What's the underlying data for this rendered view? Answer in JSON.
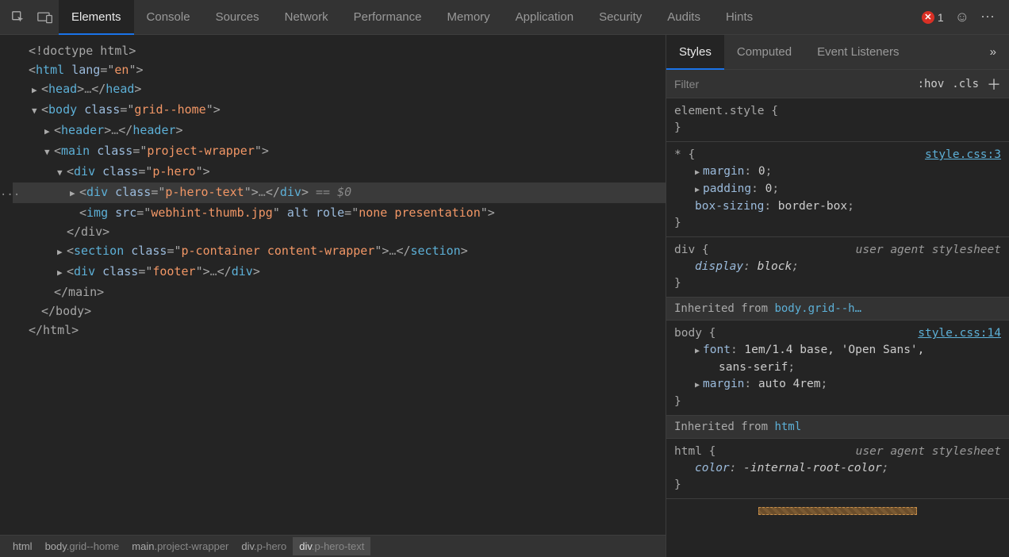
{
  "topTabs": {
    "items": [
      "Elements",
      "Console",
      "Sources",
      "Network",
      "Performance",
      "Memory",
      "Application",
      "Security",
      "Audits",
      "Hints"
    ],
    "active": 0
  },
  "errors": {
    "count": "1"
  },
  "tree": {
    "doctype": "<!doctype html>",
    "htmlOpen": {
      "tag": "html",
      "attrs": [
        {
          "n": "lang",
          "v": "en"
        }
      ]
    },
    "headCollapsed": {
      "tag": "head",
      "ell": "…"
    },
    "bodyOpen": {
      "tag": "body",
      "attrs": [
        {
          "n": "class",
          "v": "grid--home"
        }
      ]
    },
    "headerCollapsed": {
      "tag": "header",
      "ell": "…"
    },
    "mainOpen": {
      "tag": "main",
      "attrs": [
        {
          "n": "class",
          "v": "project-wrapper"
        }
      ]
    },
    "pheroOpen": {
      "tag": "div",
      "attrs": [
        {
          "n": "class",
          "v": "p-hero"
        }
      ]
    },
    "pheroTextCollapsed": {
      "tag": "div",
      "attrs": [
        {
          "n": "class",
          "v": "p-hero-text"
        }
      ],
      "ell": "…",
      "eq": "== $0"
    },
    "img": {
      "tag": "img",
      "attrs": [
        {
          "n": "src",
          "v": "webhint-thumb.jpg"
        },
        {
          "n": "alt",
          "flag": true
        },
        {
          "n": "role",
          "v": "none presentation"
        }
      ]
    },
    "pheroClose": "</div>",
    "sectionCollapsed": {
      "tag": "section",
      "attrs": [
        {
          "n": "class",
          "v": "p-container content-wrapper"
        }
      ],
      "ell": "…"
    },
    "footerCollapsed": {
      "tag": "div",
      "attrs": [
        {
          "n": "class",
          "v": "footer"
        }
      ],
      "ell": "…"
    },
    "mainClose": "</main>",
    "bodyClose": "</body>",
    "htmlClose": "</html>"
  },
  "crumbs": [
    {
      "label": "html"
    },
    {
      "label": "body",
      "suffix": ".grid--home"
    },
    {
      "label": "main",
      "suffix": ".project-wrapper"
    },
    {
      "label": "div",
      "suffix": ".p-hero"
    },
    {
      "label": "div",
      "suffix": ".p-hero-text",
      "active": true
    }
  ],
  "sideTabs": {
    "items": [
      "Styles",
      "Computed",
      "Event Listeners"
    ],
    "active": 0
  },
  "filter": {
    "placeholder": "Filter",
    "hov": ":hov",
    "cls": ".cls"
  },
  "rules": [
    {
      "selector": "element.style",
      "brace": "{",
      "props": [],
      "close": "}"
    },
    {
      "selector": "*",
      "brace": "{",
      "source": "style.css:3",
      "props": [
        {
          "n": "margin",
          "v": "0",
          "tri": true
        },
        {
          "n": "padding",
          "v": "0",
          "tri": true
        },
        {
          "n": "box-sizing",
          "v": "border-box"
        }
      ],
      "close": "}"
    },
    {
      "selector": "div",
      "brace": "{",
      "ua": "user agent stylesheet",
      "italic": true,
      "props": [
        {
          "n": "display",
          "v": "block",
          "italic": true
        }
      ],
      "close": "}"
    }
  ],
  "inherits": [
    {
      "label": "Inherited from",
      "from": "body.grid--h…",
      "rule": {
        "selector": "body",
        "brace": "{",
        "source": "style.css:14",
        "props": [
          {
            "n": "font",
            "v": "1em/1.4 base, 'Open Sans', sans-serif",
            "tri": true,
            "wrap": true
          },
          {
            "n": "margin",
            "v": "auto 4rem",
            "tri": true
          }
        ],
        "close": "}"
      }
    },
    {
      "label": "Inherited from",
      "from": "html",
      "rule": {
        "selector": "html",
        "brace": "{",
        "ua": "user agent stylesheet",
        "italic": true,
        "props": [
          {
            "n": "color",
            "v": "-internal-root-color",
            "italic": true
          }
        ],
        "close": "}"
      }
    }
  ]
}
